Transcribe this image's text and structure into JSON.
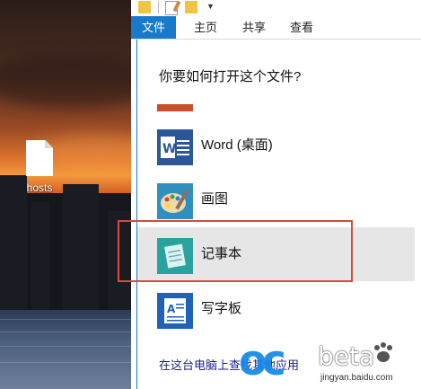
{
  "desktop": {
    "file_icon_label": "hosts"
  },
  "ribbon": {
    "tabs": [
      {
        "label": "文件",
        "active": true
      },
      {
        "label": "主页",
        "active": false
      },
      {
        "label": "共享",
        "active": false
      },
      {
        "label": "查看",
        "active": false
      }
    ]
  },
  "dialog": {
    "title": "你要如何打开这个文件?",
    "apps": [
      {
        "name": "Word (桌面)",
        "icon": "word-icon"
      },
      {
        "name": "画图",
        "icon": "paint-icon"
      },
      {
        "name": "记事本",
        "icon": "notepad-icon",
        "selected": true
      },
      {
        "name": "写字板",
        "icon": "wordpad-icon"
      }
    ],
    "store_link": "在这台电脑上查找其他应用"
  },
  "watermark": {
    "brand": "beta",
    "url": "jingyan.baidu.com"
  },
  "colors": {
    "ribbon_active": "#1979ca",
    "highlight": "#d84a3a",
    "selected_row": "#e6e6e6"
  }
}
